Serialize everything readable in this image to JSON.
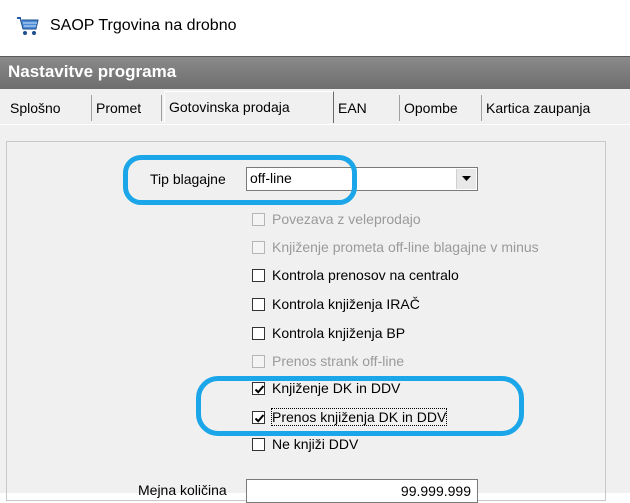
{
  "window": {
    "title": "SAOP Trgovina na drobno",
    "app_icon": "shopping-cart-icon"
  },
  "header": {
    "title": "Nastavitve programa"
  },
  "tabs": [
    {
      "label": "Splošno",
      "active": false
    },
    {
      "label": "Promet",
      "active": false
    },
    {
      "label": "Gotovinska prodaja",
      "active": true
    },
    {
      "label": "EAN",
      "active": false
    },
    {
      "label": "Opombe",
      "active": false
    },
    {
      "label": "Kartica zaupanja",
      "active": false
    }
  ],
  "form": {
    "tip_blagajne_label": "Tip blagajne",
    "tip_blagajne_value": "off-line",
    "checkboxes": [
      {
        "label": "Povezava z veleprodajo",
        "checked": false,
        "enabled": false
      },
      {
        "label": "Knjiženje prometa off-line blagajne v minus",
        "checked": false,
        "enabled": false
      },
      {
        "label": "Kontrola prenosov na centralo",
        "checked": false,
        "enabled": true
      },
      {
        "label": "Kontrola knjiženja IRAČ",
        "checked": false,
        "enabled": true
      },
      {
        "label": "Kontrola knjiženja BP",
        "checked": false,
        "enabled": true
      },
      {
        "label": "Prenos strank off-line",
        "checked": false,
        "enabled": false
      },
      {
        "label": "Knjiženje DK in DDV",
        "checked": true,
        "enabled": true
      },
      {
        "label": "Prenos knjiženja DK in DDV",
        "checked": true,
        "enabled": true
      },
      {
        "label": "Ne knjiži DDV",
        "checked": false,
        "enabled": true
      }
    ],
    "max_kolicina_label": "Mejna količina",
    "max_kolicina_value": "99.999.999"
  },
  "colors": {
    "highlight": "#1aa6e8",
    "header_bg": "#7a7a7a",
    "panel_bg": "#f0f0f0"
  }
}
